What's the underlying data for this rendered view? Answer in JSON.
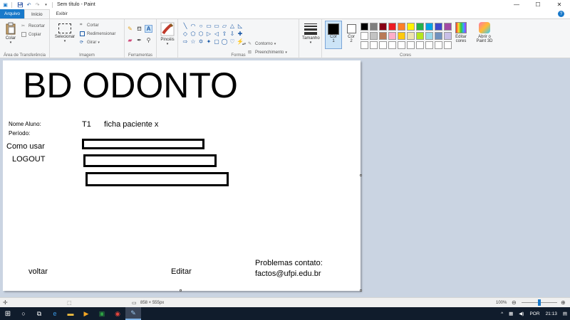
{
  "window": {
    "title": "Sem título - Paint",
    "controls": {
      "minimize": "—",
      "maximize": "☐",
      "close": "✕"
    }
  },
  "quick_access": {
    "save_icon": "save-icon",
    "undo_icon": "undo-icon",
    "redo_icon": "redo-icon"
  },
  "menu": {
    "file": "Arquivo",
    "home": "Início",
    "view": "Exibir"
  },
  "ribbon": {
    "clipboard": {
      "paste": "Colar",
      "cut": "Recortar",
      "copy": "Copiar",
      "label": "Área de Transferência"
    },
    "image": {
      "select": "Selecionar",
      "crop": "Cortar",
      "resize": "Redimensionar",
      "rotate": "Girar",
      "label": "Imagem"
    },
    "tools": {
      "label": "Ferramentas"
    },
    "brushes": {
      "label": "Pincéis"
    },
    "shapes": {
      "outline": "Contorno",
      "fill": "Preenchimento",
      "label": "Formas",
      "glyphs": [
        "╲",
        "◠",
        "○",
        "▭",
        "▭",
        "▱",
        "△",
        "◺",
        "◇",
        "⬠",
        "⬡",
        "▷",
        "◁",
        "⇧",
        "⇩",
        "✚",
        "⇨",
        "☆",
        "✡",
        "✦",
        "▢",
        "◯",
        "♡",
        "⚡"
      ]
    },
    "size": {
      "label": "Tamanho"
    },
    "color1": {
      "label": "Cor",
      "number": "1",
      "color": "#000000"
    },
    "color2": {
      "label": "Cor",
      "number": "2",
      "color": "#ffffff"
    },
    "colors": {
      "label": "Cores",
      "palette": [
        "#000000",
        "#7f7f7f",
        "#880015",
        "#ed1c24",
        "#ff7f27",
        "#fff200",
        "#22b14c",
        "#00a2e8",
        "#3f48cc",
        "#a349a4",
        "#ffffff",
        "#c3c3c3",
        "#b97a57",
        "#ffaec9",
        "#ffc90e",
        "#efe4b0",
        "#b5e61d",
        "#99d9ea",
        "#7092be",
        "#c8bfe7",
        "#ffffff",
        "#ffffff",
        "#ffffff",
        "#ffffff",
        "#ffffff",
        "#ffffff",
        "#ffffff",
        "#ffffff",
        "#ffffff",
        "#ffffff"
      ]
    },
    "edit_colors": {
      "line1": "Editar",
      "line2": "cores"
    },
    "paint3d": {
      "line1": "Abrir o",
      "line2": "Paint 3D"
    }
  },
  "canvas_content": {
    "title": "BD ODONTO",
    "nome_aluno": "Nome Aluno:",
    "periodo": "Período:",
    "t1": "T1",
    "ficha": "ficha paciente x",
    "como_usar": "Como usar",
    "logout": "LOGOUT",
    "voltar": "voltar",
    "editar": "Editar",
    "problemas": "Problemas contato:",
    "email": "factos@ufpi.edu.br"
  },
  "status": {
    "dimensions": "858 × 555px",
    "zoom": "100%"
  },
  "taskbar": {
    "language": "POR",
    "time": "21:13"
  }
}
